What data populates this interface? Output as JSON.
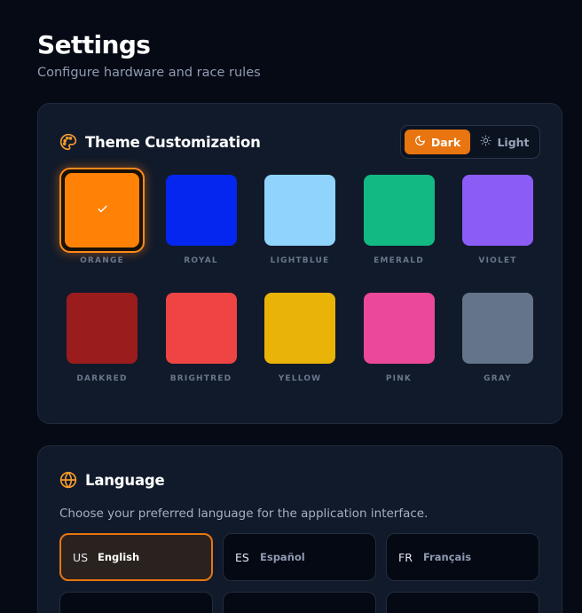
{
  "header": {
    "title": "Settings",
    "subtitle": "Configure hardware and race rules"
  },
  "theme": {
    "title": "Theme Customization",
    "icon": "palette-icon",
    "mode_toggle": {
      "dark_label": "Dark",
      "light_label": "Light",
      "selected": "Dark"
    },
    "accent": "#e87510",
    "selected_color": "ORANGE",
    "swatches": [
      {
        "label": "ORANGE",
        "color": "#ff8206",
        "selected": true
      },
      {
        "label": "ROYAL",
        "color": "#0426ee"
      },
      {
        "label": "LIGHTBLUE",
        "color": "#90d4fd"
      },
      {
        "label": "EMERALD",
        "color": "#12b982"
      },
      {
        "label": "VIOLET",
        "color": "#8b5cf6"
      },
      {
        "label": "DARKRED",
        "color": "#9a1c1c"
      },
      {
        "label": "BRIGHTRED",
        "color": "#ef4444"
      },
      {
        "label": "YELLOW",
        "color": "#eab308"
      },
      {
        "label": "PINK",
        "color": "#ec4899"
      },
      {
        "label": "GRAY",
        "color": "#64748b"
      }
    ]
  },
  "language": {
    "title": "Language",
    "icon": "globe-icon",
    "description": "Choose your preferred language for the application interface.",
    "selected": "English",
    "options": [
      {
        "code": "US",
        "name": "English",
        "selected": true
      },
      {
        "code": "ES",
        "name": "Español"
      },
      {
        "code": "FR",
        "name": "Français"
      }
    ]
  }
}
